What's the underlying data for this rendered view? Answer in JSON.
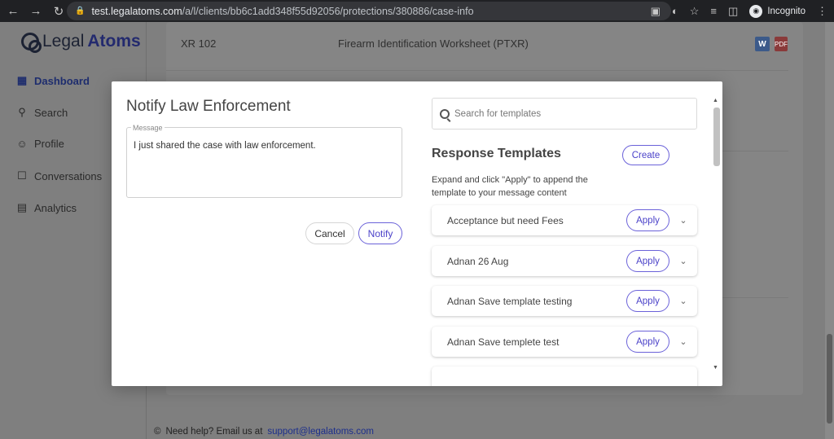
{
  "browser": {
    "url_domain": "test.legalatoms.com",
    "url_path": "/a/l/clients/bb6c1add348f55d92056/protections/380886/case-info",
    "incognito_label": "Incognito"
  },
  "sidebar": {
    "logo_part1": "Legal",
    "logo_part2": "Atoms",
    "items": [
      {
        "label": "Dashboard",
        "icon": "grid-icon"
      },
      {
        "label": "Search",
        "icon": "search-icon"
      },
      {
        "label": "Profile",
        "icon": "user-icon"
      },
      {
        "label": "Conversations",
        "icon": "chat-icon"
      },
      {
        "label": "Analytics",
        "icon": "chart-icon"
      }
    ]
  },
  "background_row": {
    "form_id": "XR 102",
    "form_title": "Firearm Identification Worksheet (PTXR)",
    "word_label": "W",
    "pdf_label": "PDF"
  },
  "footer": {
    "help_text": "Need help? Email us at",
    "email": "support@legalatoms.com"
  },
  "modal": {
    "title": "Notify Law Enforcement",
    "message_label": "Message",
    "message_value": "I just shared the case with law enforcement.",
    "cancel_label": "Cancel",
    "notify_label": "Notify",
    "search_placeholder": "Search for templates",
    "templates_heading": "Response Templates",
    "create_label": "Create",
    "help_text": "Expand and click \"Apply\" to append the template to your message content",
    "apply_label": "Apply",
    "templates": [
      "Acceptance but need Fees",
      "Adnan 26 Aug",
      "Adnan Save template testing",
      "Adnan Save templete test"
    ]
  }
}
